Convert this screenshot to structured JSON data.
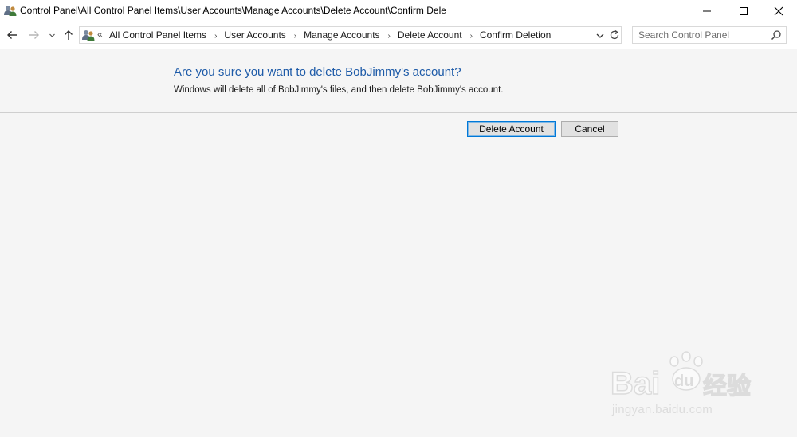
{
  "window": {
    "title": "Control Panel\\All Control Panel Items\\User Accounts\\Manage Accounts\\Delete Account\\Confirm Dele",
    "icon": "user-accounts-icon",
    "controls": {
      "minimize": "minimize-icon",
      "maximize": "maximize-icon",
      "close": "close-icon"
    }
  },
  "nav": {
    "back": "back-arrow-icon",
    "forward": "forward-arrow-icon",
    "recent": "chevron-down-icon",
    "up": "up-arrow-icon"
  },
  "address": {
    "overflow": "«",
    "breadcrumbs": [
      "All Control Panel Items",
      "User Accounts",
      "Manage Accounts",
      "Delete Account",
      "Confirm Deletion"
    ],
    "separator": "›"
  },
  "search": {
    "placeholder": "Search Control Panel",
    "value": ""
  },
  "content": {
    "heading": "Are you sure you want to delete BobJimmy's account?",
    "description": "Windows will delete all of BobJimmy's files, and then delete BobJimmy's account."
  },
  "buttons": {
    "delete": "Delete Account",
    "cancel": "Cancel"
  },
  "watermark": {
    "brand": "Baidu 经验",
    "url": "jingyan.baidu.com"
  },
  "colors": {
    "heading": "#1e5ba8",
    "background": "#f5f5f5",
    "accent": "#0078d7"
  }
}
